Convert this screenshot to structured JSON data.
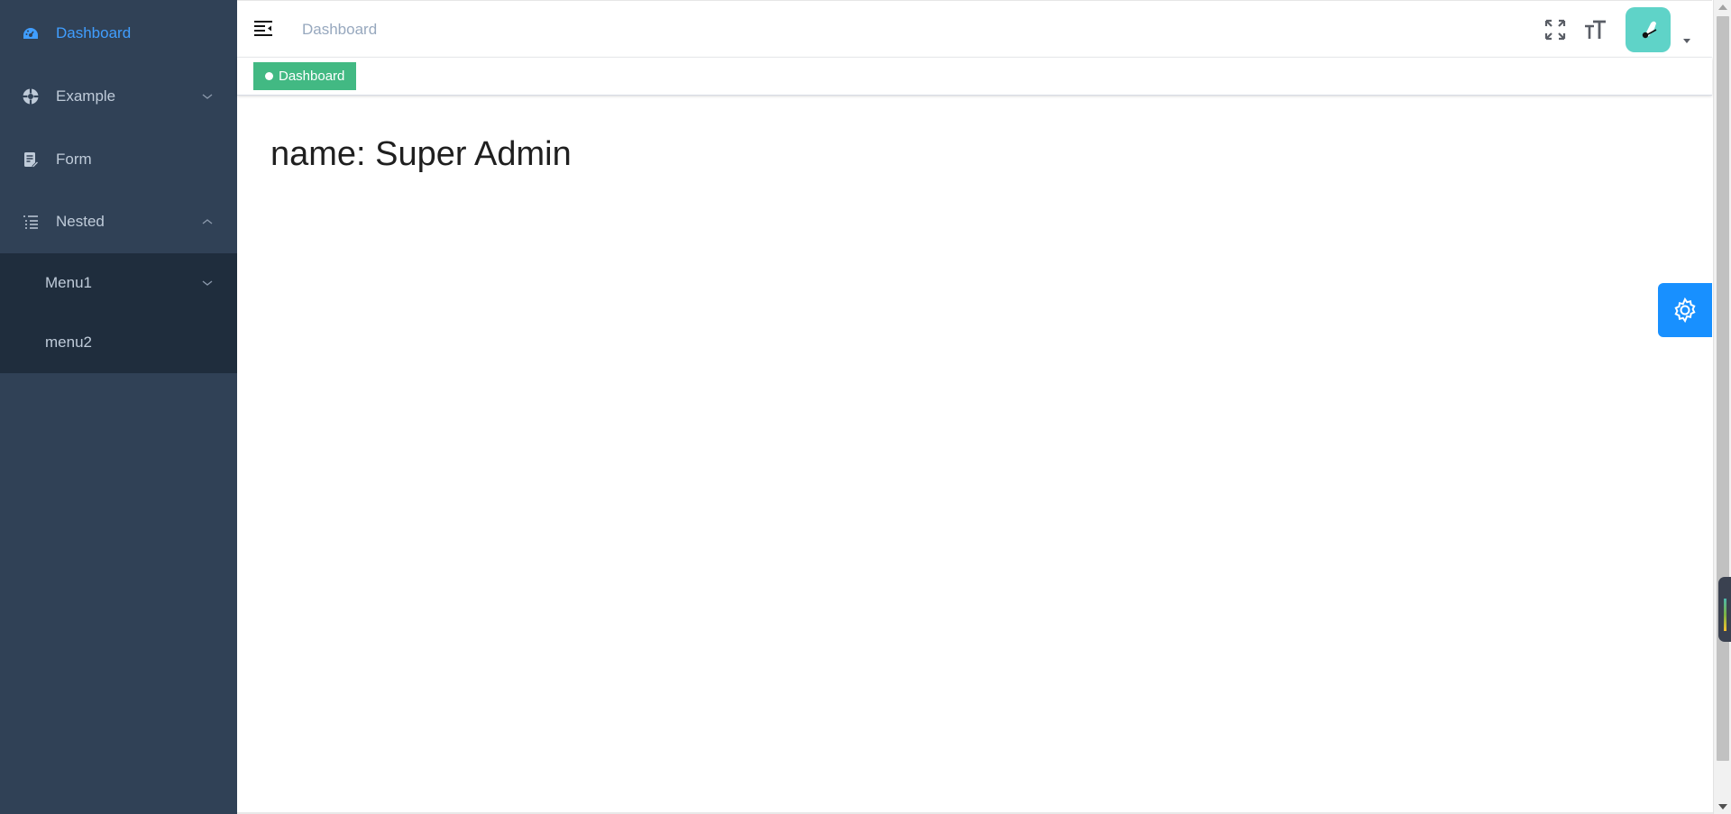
{
  "sidebar": {
    "items": [
      {
        "label": "Dashboard",
        "icon": "dashboard-icon",
        "active": true
      },
      {
        "label": "Example",
        "icon": "example-icon",
        "expandable": true,
        "expanded": false
      },
      {
        "label": "Form",
        "icon": "form-icon"
      },
      {
        "label": "Nested",
        "icon": "nested-icon",
        "expandable": true,
        "expanded": true
      }
    ],
    "submenu": [
      {
        "label": "Menu1",
        "expandable": true,
        "expanded": false
      },
      {
        "label": "menu2"
      }
    ]
  },
  "navbar": {
    "breadcrumb": "Dashboard",
    "icons": [
      "hamburger-icon",
      "fullscreen-icon",
      "font-size-icon",
      "avatar",
      "caret-down-icon"
    ]
  },
  "tags": [
    {
      "label": "Dashboard",
      "active": true
    }
  ],
  "main": {
    "title": "name: Super Admin"
  },
  "settings": {
    "icon": "gear-icon"
  },
  "colors": {
    "sidebar_bg": "#304156",
    "submenu_bg": "#1f2d3d",
    "menu_text": "#bfcbd9",
    "active_text": "#409eff",
    "tag_active": "#42b983",
    "settings_bg": "#1890ff",
    "avatar_bg": "#5fd3c8"
  }
}
